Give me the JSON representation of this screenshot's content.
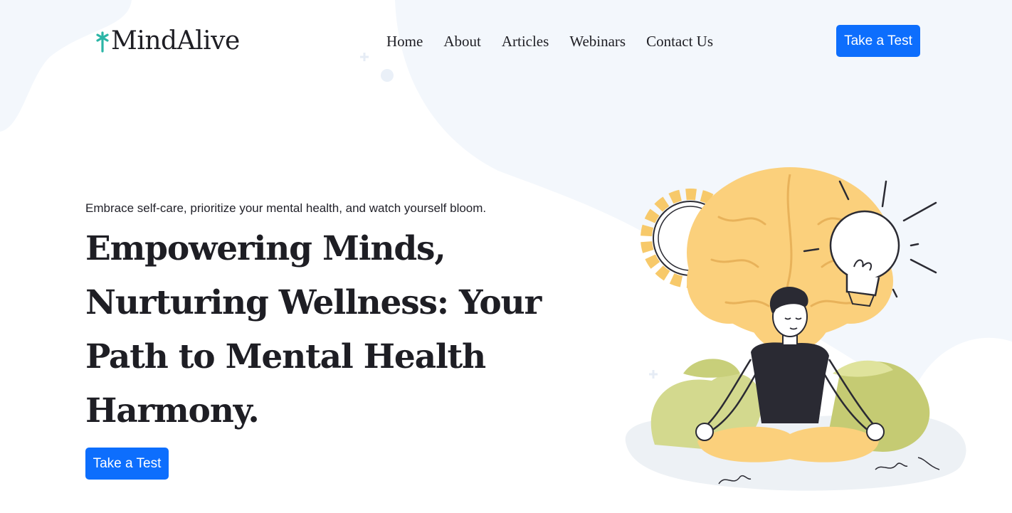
{
  "brand": {
    "name": "MindAlive",
    "accent": "#2bb5a6"
  },
  "nav": {
    "items": [
      {
        "label": "Home"
      },
      {
        "label": "About"
      },
      {
        "label": "Articles"
      },
      {
        "label": "Webinars"
      },
      {
        "label": "Contact Us"
      }
    ],
    "cta_label": "Take a Test"
  },
  "hero": {
    "tagline": "Embrace self-care, prioritize your mental health, and watch yourself bloom.",
    "title_lines": [
      "Empowering Minds,",
      "Nurturing Wellness: Your",
      "Path to Mental Health",
      "Harmony."
    ],
    "cta_label": "Take a Test"
  },
  "colors": {
    "primary_button": "#0d6efd",
    "background_blob": "#f3f7fc",
    "text": "#1e1e24"
  },
  "illustration": {
    "icon": "meditating-person-brain-illustration"
  }
}
